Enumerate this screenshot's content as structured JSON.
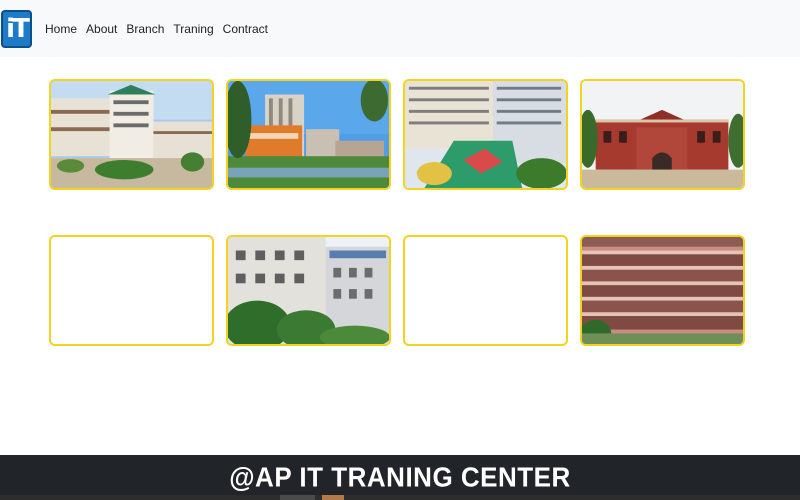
{
  "navbar": {
    "logo_text": "iT",
    "links": [
      "Home",
      "About",
      "Branch",
      "Traning",
      "Contract"
    ]
  },
  "gallery": {
    "cards": [
      {
        "row": 1,
        "col": 1,
        "image": "campus-building-photo"
      },
      {
        "row": 1,
        "col": 2,
        "image": "modern-campus-tower-photo"
      },
      {
        "row": 1,
        "col": 3,
        "image": "school-courtyard-photo"
      },
      {
        "row": 1,
        "col": 4,
        "image": "red-brick-building-photo"
      },
      {
        "row": 2,
        "col": 1,
        "image": "empty-placeholder"
      },
      {
        "row": 2,
        "col": 2,
        "image": "white-academic-building-photo"
      },
      {
        "row": 2,
        "col": 3,
        "image": "empty-placeholder"
      },
      {
        "row": 2,
        "col": 4,
        "image": "pink-multi-storey-building-photo"
      }
    ]
  },
  "footer": {
    "text": "@AP IT TRANING CENTER"
  },
  "colors": {
    "navbar_bg": "#f8f9fa",
    "card_border": "#f2d31f",
    "footer_bg": "#212529",
    "logo_bg": "#1c7cc7"
  }
}
